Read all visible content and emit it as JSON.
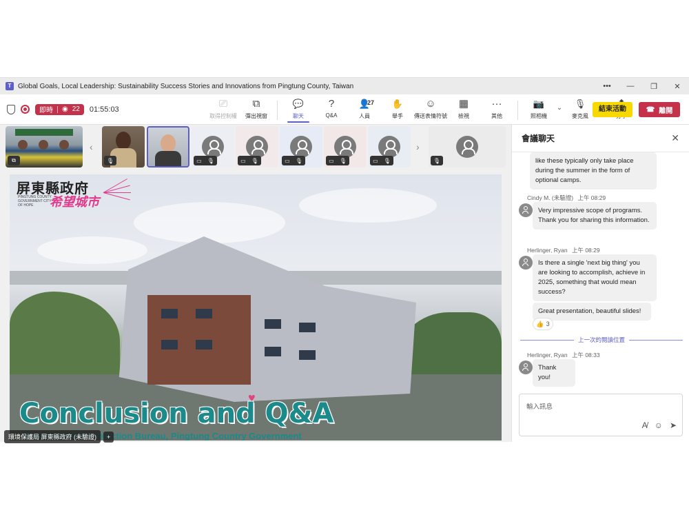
{
  "window": {
    "title": "Global Goals, Local Leadership: Sustainability Success Stories and Innovations from Pingtung County, Taiwan",
    "app_icon": "T",
    "controls": [
      "•••",
      "—",
      "❐",
      "✕"
    ]
  },
  "toolbar": {
    "live_label": "即時",
    "viewers": "22",
    "timer": "01:55:03",
    "tools": [
      {
        "label": "取得控制權",
        "icon": "screen-share-icon",
        "glyph": "⎚"
      },
      {
        "label": "彈出視窗",
        "icon": "pop-out-icon",
        "glyph": "⧉"
      },
      {
        "label": "聊天",
        "icon": "chat-icon",
        "glyph": "💬"
      },
      {
        "label": "Q&A",
        "icon": "qa-icon",
        "glyph": "?"
      },
      {
        "label": "人員",
        "icon": "people-icon",
        "glyph": "👤",
        "count": "27"
      },
      {
        "label": "舉手",
        "icon": "raise-hand-icon",
        "glyph": "✋"
      },
      {
        "label": "傳送表情符號",
        "icon": "emoji-icon",
        "glyph": "☺"
      },
      {
        "label": "檢視",
        "icon": "view-icon",
        "glyph": "▦"
      },
      {
        "label": "其他",
        "icon": "more-icon",
        "glyph": "···"
      },
      {
        "label": "照相機",
        "icon": "camera-off-icon",
        "glyph": "📷"
      },
      {
        "label": "麥克風",
        "icon": "mic-off-icon",
        "glyph": "🎙"
      },
      {
        "label": "分享",
        "icon": "share-icon",
        "glyph": "⬆"
      }
    ],
    "end_activity": "結束活動",
    "leave": "離開",
    "leave_icon": "☎"
  },
  "gallery": {
    "prev_arrow": "‹",
    "next_arrow": "›",
    "ctrl_camera": "▭",
    "ctrl_mic": "🎙",
    "ctrl_share": "⧉"
  },
  "slide": {
    "logo_main": "屏東縣政府",
    "logo_sub": "PINGTUNG COUNTY GOVERNMENT CITY OF HOPE",
    "logo_hope": "希望城市",
    "heading": "Conclusion and Q&A",
    "heart": "♥",
    "footer": "Environmental Protection Bureau, Pingtung Country Government"
  },
  "presenter": {
    "name_tag": "環境保護局 屏東縣政府 (未驗證)",
    "add": "+"
  },
  "chat": {
    "title": "會議聊天",
    "close": "✕",
    "messages": [
      {
        "text": "like these typically only take place during the summer in the form of optional camps."
      },
      {
        "author": "Cindy M. (未驗證)",
        "time": "上午 08:29",
        "text": "Very impressive scope of programs. Thank you for sharing this information."
      },
      {
        "author": "Herlinger, Ryan",
        "time": "上午 08:29",
        "text": "Is there a single 'next big thing' you are looking to accomplish, achieve in 2025, something that would mean success?"
      },
      {
        "text": "Great presentation, beautiful slides!",
        "reaction_icon": "👍",
        "reaction_count": "3"
      },
      {
        "author": "Herlinger, Ryan",
        "time": "上午 08:33",
        "text": "Thank you!"
      }
    ],
    "last_read": "上一次的閱讀位置",
    "compose_placeholder": "輸入訊息",
    "compose_tools": [
      "A̸",
      "☺",
      "➤"
    ]
  }
}
